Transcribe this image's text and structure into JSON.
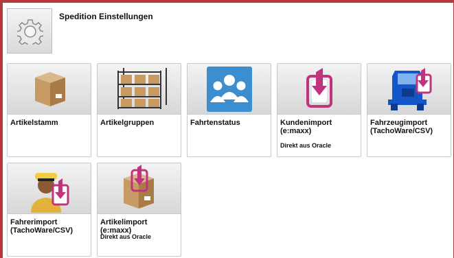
{
  "header": {
    "title": "Spedition Einstellungen",
    "icon": "gear-icon"
  },
  "tiles": [
    {
      "label": "Artikelstamm",
      "sub": "",
      "icon": "box-icon"
    },
    {
      "label": "Artikelgruppen",
      "sub": "",
      "icon": "shelf-icon"
    },
    {
      "label": "Fahrtenstatus",
      "sub": "",
      "icon": "people-icon"
    },
    {
      "label": "Kundenimport (e:maxx)",
      "sub": "Direkt aus Oracle",
      "icon": "import-icon"
    },
    {
      "label": "Fahrzeugimport (TachoWare/CSV)",
      "sub": "",
      "icon": "truck-import-icon"
    },
    {
      "label": "Fahrerimport (TachoWare/CSV)",
      "sub": "",
      "icon": "driver-import-icon"
    },
    {
      "label": "Artikelimport (e:maxx)",
      "sub": "Direkt aus Oracle",
      "icon": "box-import-icon"
    }
  ],
  "colors": {
    "frame": "#b8373a",
    "import_magenta": "#c2337e",
    "truck_blue": "#1456c7"
  }
}
